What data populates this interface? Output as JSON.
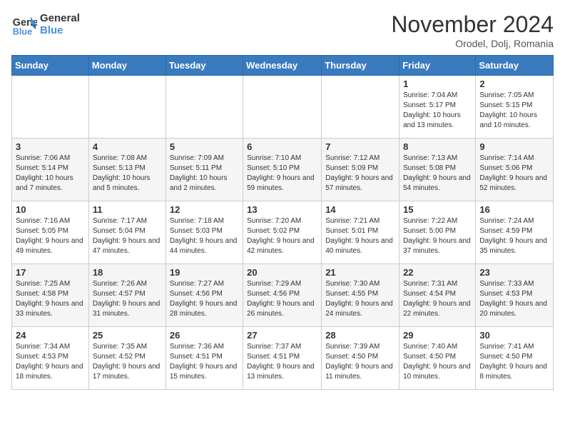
{
  "header": {
    "logo_line1": "General",
    "logo_line2": "Blue",
    "month": "November 2024",
    "location": "Orodel, Dolj, Romania"
  },
  "weekdays": [
    "Sunday",
    "Monday",
    "Tuesday",
    "Wednesday",
    "Thursday",
    "Friday",
    "Saturday"
  ],
  "weeks": [
    [
      {
        "day": "",
        "info": ""
      },
      {
        "day": "",
        "info": ""
      },
      {
        "day": "",
        "info": ""
      },
      {
        "day": "",
        "info": ""
      },
      {
        "day": "",
        "info": ""
      },
      {
        "day": "1",
        "info": "Sunrise: 7:04 AM\nSunset: 5:17 PM\nDaylight: 10 hours and 13 minutes."
      },
      {
        "day": "2",
        "info": "Sunrise: 7:05 AM\nSunset: 5:15 PM\nDaylight: 10 hours and 10 minutes."
      }
    ],
    [
      {
        "day": "3",
        "info": "Sunrise: 7:06 AM\nSunset: 5:14 PM\nDaylight: 10 hours and 7 minutes."
      },
      {
        "day": "4",
        "info": "Sunrise: 7:08 AM\nSunset: 5:13 PM\nDaylight: 10 hours and 5 minutes."
      },
      {
        "day": "5",
        "info": "Sunrise: 7:09 AM\nSunset: 5:11 PM\nDaylight: 10 hours and 2 minutes."
      },
      {
        "day": "6",
        "info": "Sunrise: 7:10 AM\nSunset: 5:10 PM\nDaylight: 9 hours and 59 minutes."
      },
      {
        "day": "7",
        "info": "Sunrise: 7:12 AM\nSunset: 5:09 PM\nDaylight: 9 hours and 57 minutes."
      },
      {
        "day": "8",
        "info": "Sunrise: 7:13 AM\nSunset: 5:08 PM\nDaylight: 9 hours and 54 minutes."
      },
      {
        "day": "9",
        "info": "Sunrise: 7:14 AM\nSunset: 5:06 PM\nDaylight: 9 hours and 52 minutes."
      }
    ],
    [
      {
        "day": "10",
        "info": "Sunrise: 7:16 AM\nSunset: 5:05 PM\nDaylight: 9 hours and 49 minutes."
      },
      {
        "day": "11",
        "info": "Sunrise: 7:17 AM\nSunset: 5:04 PM\nDaylight: 9 hours and 47 minutes."
      },
      {
        "day": "12",
        "info": "Sunrise: 7:18 AM\nSunset: 5:03 PM\nDaylight: 9 hours and 44 minutes."
      },
      {
        "day": "13",
        "info": "Sunrise: 7:20 AM\nSunset: 5:02 PM\nDaylight: 9 hours and 42 minutes."
      },
      {
        "day": "14",
        "info": "Sunrise: 7:21 AM\nSunset: 5:01 PM\nDaylight: 9 hours and 40 minutes."
      },
      {
        "day": "15",
        "info": "Sunrise: 7:22 AM\nSunset: 5:00 PM\nDaylight: 9 hours and 37 minutes."
      },
      {
        "day": "16",
        "info": "Sunrise: 7:24 AM\nSunset: 4:59 PM\nDaylight: 9 hours and 35 minutes."
      }
    ],
    [
      {
        "day": "17",
        "info": "Sunrise: 7:25 AM\nSunset: 4:58 PM\nDaylight: 9 hours and 33 minutes."
      },
      {
        "day": "18",
        "info": "Sunrise: 7:26 AM\nSunset: 4:57 PM\nDaylight: 9 hours and 31 minutes."
      },
      {
        "day": "19",
        "info": "Sunrise: 7:27 AM\nSunset: 4:56 PM\nDaylight: 9 hours and 28 minutes."
      },
      {
        "day": "20",
        "info": "Sunrise: 7:29 AM\nSunset: 4:56 PM\nDaylight: 9 hours and 26 minutes."
      },
      {
        "day": "21",
        "info": "Sunrise: 7:30 AM\nSunset: 4:55 PM\nDaylight: 9 hours and 24 minutes."
      },
      {
        "day": "22",
        "info": "Sunrise: 7:31 AM\nSunset: 4:54 PM\nDaylight: 9 hours and 22 minutes."
      },
      {
        "day": "23",
        "info": "Sunrise: 7:33 AM\nSunset: 4:53 PM\nDaylight: 9 hours and 20 minutes."
      }
    ],
    [
      {
        "day": "24",
        "info": "Sunrise: 7:34 AM\nSunset: 4:53 PM\nDaylight: 9 hours and 18 minutes."
      },
      {
        "day": "25",
        "info": "Sunrise: 7:35 AM\nSunset: 4:52 PM\nDaylight: 9 hours and 17 minutes."
      },
      {
        "day": "26",
        "info": "Sunrise: 7:36 AM\nSunset: 4:51 PM\nDaylight: 9 hours and 15 minutes."
      },
      {
        "day": "27",
        "info": "Sunrise: 7:37 AM\nSunset: 4:51 PM\nDaylight: 9 hours and 13 minutes."
      },
      {
        "day": "28",
        "info": "Sunrise: 7:39 AM\nSunset: 4:50 PM\nDaylight: 9 hours and 11 minutes."
      },
      {
        "day": "29",
        "info": "Sunrise: 7:40 AM\nSunset: 4:50 PM\nDaylight: 9 hours and 10 minutes."
      },
      {
        "day": "30",
        "info": "Sunrise: 7:41 AM\nSunset: 4:50 PM\nDaylight: 9 hours and 8 minutes."
      }
    ]
  ]
}
